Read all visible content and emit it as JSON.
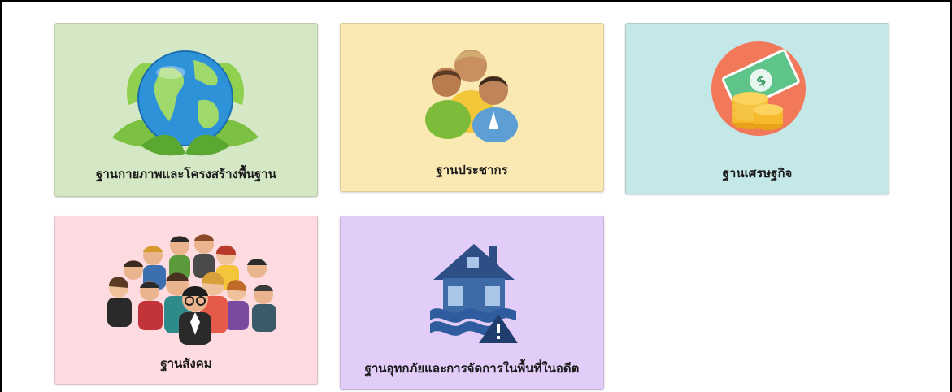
{
  "cards": [
    {
      "label": "ฐานกายภาพและโครงสร้างพื้นฐาน",
      "icon": "globe-leaves-icon",
      "color": "#d5e8c6"
    },
    {
      "label": "ฐานประชากร",
      "icon": "people-group-icon",
      "color": "#fae9b3"
    },
    {
      "label": "ฐานเศรษฐกิจ",
      "icon": "money-coins-icon",
      "color": "#c4e7e7"
    },
    {
      "label": "ฐานสังคม",
      "icon": "crowd-icon",
      "color": "#fddbe1"
    },
    {
      "label": "ฐานอุทกภัยและการจัดการในพื้นที่ในอดีต",
      "icon": "flood-house-icon",
      "color": "#e2ccf8"
    }
  ]
}
